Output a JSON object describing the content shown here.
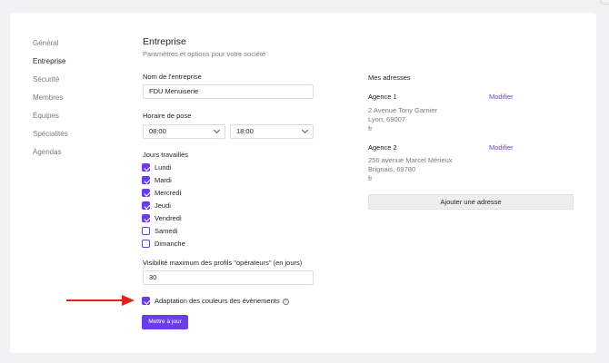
{
  "nav": {
    "items": [
      "Général",
      "Entreprise",
      "Sécurité",
      "Membres",
      "Équipes",
      "Spécialités",
      "Agendas"
    ]
  },
  "page": {
    "title": "Entreprise",
    "subtitle": "Paramètres et options pour votre société"
  },
  "form": {
    "company_name_label": "Nom de l'entreprise",
    "company_name_value": "FDU Menuiserie",
    "schedule_label": "Horaire de pose",
    "schedule_start": "08:00",
    "schedule_end": "18:00",
    "workdays_label": "Jours travaillés",
    "workdays": [
      {
        "label": "Lundi",
        "checked": true
      },
      {
        "label": "Mardi",
        "checked": true
      },
      {
        "label": "Mercredi",
        "checked": true
      },
      {
        "label": "Jeudi",
        "checked": true
      },
      {
        "label": "Vendredi",
        "checked": true
      },
      {
        "label": "Samedi",
        "checked": false
      },
      {
        "label": "Dimanche",
        "checked": false
      }
    ],
    "visibility_label": "Visibilité maximum des profils \"opérateurs\" (en jours)",
    "visibility_value": "30",
    "color_adapt_label": "Adaptation des couleurs des évènements",
    "color_adapt_checked": true,
    "submit_label": "Mettre à jour"
  },
  "addresses": {
    "title": "Mes adresses",
    "items": [
      {
        "name": "Agence 1",
        "line1": "2 Avenue Tony Garnier",
        "line2": "Lyon, 69007",
        "country": "fr",
        "edit_label": "Modifier"
      },
      {
        "name": "Agence 2",
        "line1": "256 avenue Marcel Mérieux",
        "line2": "Brignais, 69780",
        "country": "fr",
        "edit_label": "Modifier"
      }
    ],
    "add_label": "Ajouter une adresse"
  },
  "colors": {
    "accent": "#6a3de8",
    "arrow": "#e0241b"
  }
}
